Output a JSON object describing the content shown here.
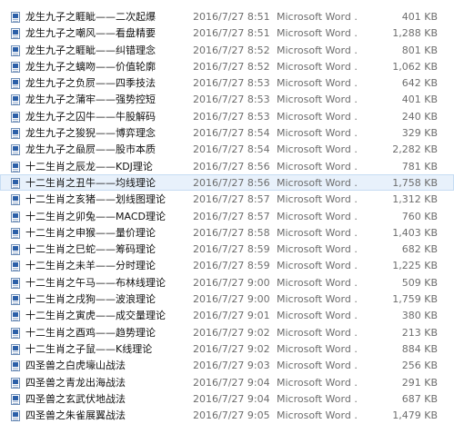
{
  "files": [
    {
      "name": "龙生九子之睚眦——二次起爆",
      "date": "2016/7/27 8:51",
      "type": "Microsoft Word ...",
      "size": "401 KB"
    },
    {
      "name": "龙生九子之嘲风——看盘精要",
      "date": "2016/7/27 8:51",
      "type": "Microsoft Word ...",
      "size": "1,288 KB"
    },
    {
      "name": "龙生九子之睚眦——纠错理念",
      "date": "2016/7/27 8:52",
      "type": "Microsoft Word ...",
      "size": "801 KB"
    },
    {
      "name": "龙生九子之螭吻——价值轮廓",
      "date": "2016/7/27 8:52",
      "type": "Microsoft Word ...",
      "size": "1,062 KB"
    },
    {
      "name": "龙生九子之负屃——四季技法",
      "date": "2016/7/27 8:53",
      "type": "Microsoft Word ...",
      "size": "642 KB"
    },
    {
      "name": "龙生九子之蒲牢——强势控短",
      "date": "2016/7/27 8:53",
      "type": "Microsoft Word ...",
      "size": "401 KB"
    },
    {
      "name": "龙生九子之囚牛——牛股解码",
      "date": "2016/7/27 8:53",
      "type": "Microsoft Word ...",
      "size": "240 KB"
    },
    {
      "name": "龙生九子之狻猊——博弈理念",
      "date": "2016/7/27 8:54",
      "type": "Microsoft Word ...",
      "size": "329 KB"
    },
    {
      "name": "龙生九子之赑屃——股市本质",
      "date": "2016/7/27 8:54",
      "type": "Microsoft Word ...",
      "size": "2,282 KB"
    },
    {
      "name": "十二生肖之辰龙——KDJ理论",
      "date": "2016/7/27 8:56",
      "type": "Microsoft Word ...",
      "size": "781 KB"
    },
    {
      "name": "十二生肖之丑牛——均线理论",
      "date": "2016/7/27 8:56",
      "type": "Microsoft Word ...",
      "size": "1,758 KB"
    },
    {
      "name": "十二生肖之亥猪——划线图理论",
      "date": "2016/7/27 8:57",
      "type": "Microsoft Word ...",
      "size": "1,312 KB"
    },
    {
      "name": "十二生肖之卯兔——MACD理论",
      "date": "2016/7/27 8:57",
      "type": "Microsoft Word ...",
      "size": "760 KB"
    },
    {
      "name": "十二生肖之申猴——量价理论",
      "date": "2016/7/27 8:58",
      "type": "Microsoft Word ...",
      "size": "1,403 KB"
    },
    {
      "name": "十二生肖之巳蛇——筹码理论",
      "date": "2016/7/27 8:59",
      "type": "Microsoft Word ...",
      "size": "682 KB"
    },
    {
      "name": "十二生肖之未羊——分时理论",
      "date": "2016/7/27 8:59",
      "type": "Microsoft Word ...",
      "size": "1,225 KB"
    },
    {
      "name": "十二生肖之午马——布林线理论",
      "date": "2016/7/27 9:00",
      "type": "Microsoft Word ...",
      "size": "509 KB"
    },
    {
      "name": "十二生肖之戌狗——波浪理论",
      "date": "2016/7/27 9:00",
      "type": "Microsoft Word ...",
      "size": "1,759 KB"
    },
    {
      "name": "十二生肖之寅虎——成交量理论",
      "date": "2016/7/27 9:01",
      "type": "Microsoft Word ...",
      "size": "380 KB"
    },
    {
      "name": "十二生肖之酉鸡——趋势理论",
      "date": "2016/7/27 9:02",
      "type": "Microsoft Word ...",
      "size": "213 KB"
    },
    {
      "name": "十二生肖之子鼠——K线理论",
      "date": "2016/7/27 9:02",
      "type": "Microsoft Word ...",
      "size": "884 KB"
    },
    {
      "name": "四圣兽之白虎壕山战法",
      "date": "2016/7/27 9:03",
      "type": "Microsoft Word ...",
      "size": "256 KB"
    },
    {
      "name": "四圣兽之青龙出海战法",
      "date": "2016/7/27 9:04",
      "type": "Microsoft Word ...",
      "size": "291 KB"
    },
    {
      "name": "四圣兽之玄武伏地战法",
      "date": "2016/7/27 9:04",
      "type": "Microsoft Word ...",
      "size": "687 KB"
    },
    {
      "name": "四圣兽之朱雀展翼战法",
      "date": "2016/7/27 9:05",
      "type": "Microsoft Word ...",
      "size": "1,479 KB"
    }
  ],
  "selected_index": 10,
  "icon": "word-document-icon",
  "colors": {
    "selection_background": "#e8f1fb",
    "selection_border": "#c6dcf3",
    "detail_text": "#6d6d6d",
    "name_text": "#111111"
  }
}
